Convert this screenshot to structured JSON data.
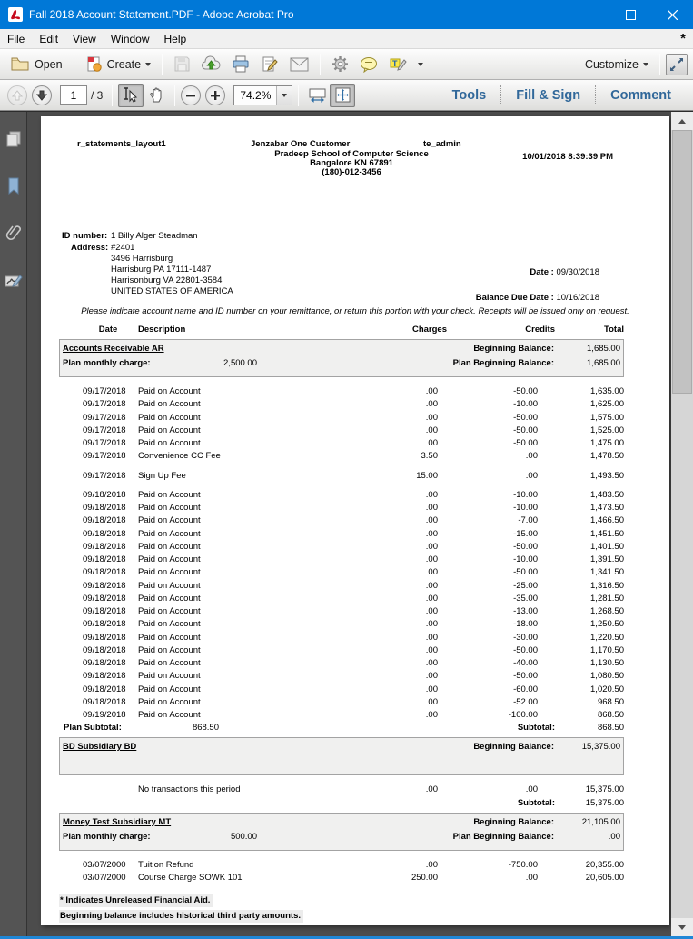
{
  "window": {
    "title": "Fall 2018 Account Statement.PDF - Adobe Acrobat Pro"
  },
  "menu": {
    "items": [
      "File",
      "Edit",
      "View",
      "Window",
      "Help"
    ]
  },
  "toolbar": {
    "open": "Open",
    "create": "Create",
    "customize": "Customize"
  },
  "navbar": {
    "page": "1",
    "page_total": "/ 3",
    "zoom": "74.2%",
    "tools": "Tools",
    "fill_sign": "Fill & Sign",
    "comment": "Comment"
  },
  "icons": {
    "titlebar": "acrobat-pdf-logo",
    "toolbar": [
      "open-folder-icon",
      "create-document-icon",
      "save-icon",
      "share-upload-icon",
      "print-icon",
      "sign-document-icon",
      "email-icon",
      "gear-icon",
      "comment-bubble-icon",
      "text-highlight-icon",
      "more-tools-chevron",
      "expand-window-icon"
    ],
    "navbar": [
      "previous-page-icon",
      "next-page-icon",
      "select-tool-icon",
      "hand-tool-icon",
      "zoom-out-icon",
      "zoom-in-icon",
      "fit-width-icon",
      "fit-page-icon"
    ],
    "sidebar": [
      "page-thumbnails-icon",
      "bookmarks-icon",
      "attachments-icon",
      "signatures-icon"
    ]
  },
  "statement": {
    "report_id": "r_statements_layout1",
    "customer": "Jenzabar One Customer",
    "admin_user": "te_admin",
    "school": {
      "name": "Pradeep School of Computer Science",
      "city_line": "Bangalore KN 67891",
      "phone": "(180)-012-3456"
    },
    "printed": "10/01/2018 8:39:39 PM",
    "id_label": "ID number:",
    "id_value": "1 Billy Alger Steadman",
    "address_label": "Address:",
    "address_lines": [
      "#2401",
      "3496 Harrisburg",
      "Harrisburg PA  17111-1487",
      "Harrisonburg VA 22801-3584",
      "UNITED STATES OF AMERICA"
    ],
    "date_label": "Date :",
    "date_value": "09/30/2018",
    "balance_due_label": "Balance Due Date :",
    "balance_due_value": "10/16/2018",
    "notice": "Please indicate account name and ID number on your remittance, or return this portion with your check.  Receipts will be issued only on request.",
    "columns": {
      "date": "Date",
      "description": "Description",
      "charges": "Charges",
      "credits": "Credits",
      "total": "Total"
    },
    "labels": {
      "beginning_balance": "Beginning Balance:",
      "plan_beginning_balance": "Plan Beginning Balance:",
      "plan_monthly_charge": "Plan monthly charge:",
      "plan_subtotal": "Plan Subtotal:",
      "subtotal": "Subtotal:"
    },
    "sections": [
      {
        "title": "Accounts Receivable AR",
        "beginning_balance": "1,685.00",
        "plan_monthly_charge": "2,500.00",
        "plan_beginning_balance": "1,685.00",
        "transactions": [
          {
            "date": "09/17/2018",
            "description": "Paid on Account",
            "charges": ".00",
            "credits": "-50.00",
            "total": "1,635.00"
          },
          {
            "date": "09/17/2018",
            "description": "Paid on Account",
            "charges": ".00",
            "credits": "-10.00",
            "total": "1,625.00"
          },
          {
            "date": "09/17/2018",
            "description": "Paid on Account",
            "charges": ".00",
            "credits": "-50.00",
            "total": "1,575.00"
          },
          {
            "date": "09/17/2018",
            "description": "Paid on Account",
            "charges": ".00",
            "credits": "-50.00",
            "total": "1,525.00"
          },
          {
            "date": "09/17/2018",
            "description": "Paid on Account",
            "charges": ".00",
            "credits": "-50.00",
            "total": "1,475.00"
          },
          {
            "date": "09/17/2018",
            "description": "Convenience CC Fee",
            "charges": "3.50",
            "credits": ".00",
            "total": "1,478.50"
          },
          {
            "date": "09/17/2018",
            "description": "Sign Up Fee",
            "charges": "15.00",
            "credits": ".00",
            "total": "1,493.50",
            "gap": true
          },
          {
            "date": "09/18/2018",
            "description": "Paid on Account",
            "charges": ".00",
            "credits": "-10.00",
            "total": "1,483.50",
            "gap": true
          },
          {
            "date": "09/18/2018",
            "description": "Paid on Account",
            "charges": ".00",
            "credits": "-10.00",
            "total": "1,473.50"
          },
          {
            "date": "09/18/2018",
            "description": "Paid on Account",
            "charges": ".00",
            "credits": "-7.00",
            "total": "1,466.50"
          },
          {
            "date": "09/18/2018",
            "description": "Paid on Account",
            "charges": ".00",
            "credits": "-15.00",
            "total": "1,451.50"
          },
          {
            "date": "09/18/2018",
            "description": "Paid on Account",
            "charges": ".00",
            "credits": "-50.00",
            "total": "1,401.50"
          },
          {
            "date": "09/18/2018",
            "description": "Paid on Account",
            "charges": ".00",
            "credits": "-10.00",
            "total": "1,391.50"
          },
          {
            "date": "09/18/2018",
            "description": "Paid on Account",
            "charges": ".00",
            "credits": "-50.00",
            "total": "1,341.50"
          },
          {
            "date": "09/18/2018",
            "description": "Paid on Account",
            "charges": ".00",
            "credits": "-25.00",
            "total": "1,316.50"
          },
          {
            "date": "09/18/2018",
            "description": "Paid on Account",
            "charges": ".00",
            "credits": "-35.00",
            "total": "1,281.50"
          },
          {
            "date": "09/18/2018",
            "description": "Paid on Account",
            "charges": ".00",
            "credits": "-13.00",
            "total": "1,268.50"
          },
          {
            "date": "09/18/2018",
            "description": "Paid on Account",
            "charges": ".00",
            "credits": "-18.00",
            "total": "1,250.50"
          },
          {
            "date": "09/18/2018",
            "description": "Paid on Account",
            "charges": ".00",
            "credits": "-30.00",
            "total": "1,220.50"
          },
          {
            "date": "09/18/2018",
            "description": "Paid on Account",
            "charges": ".00",
            "credits": "-50.00",
            "total": "1,170.50"
          },
          {
            "date": "09/18/2018",
            "description": "Paid on Account",
            "charges": ".00",
            "credits": "-40.00",
            "total": "1,130.50"
          },
          {
            "date": "09/18/2018",
            "description": "Paid on Account",
            "charges": ".00",
            "credits": "-50.00",
            "total": "1,080.50"
          },
          {
            "date": "09/18/2018",
            "description": "Paid on Account",
            "charges": ".00",
            "credits": "-60.00",
            "total": "1,020.50"
          },
          {
            "date": "09/18/2018",
            "description": "Paid on Account",
            "charges": ".00",
            "credits": "-52.00",
            "total": "968.50"
          },
          {
            "date": "09/19/2018",
            "description": "Paid on Account",
            "charges": ".00",
            "credits": "-100.00",
            "total": "868.50"
          }
        ],
        "plan_subtotal": "868.50",
        "subtotal": "868.50"
      },
      {
        "title": "BD Subsidiary BD",
        "beginning_balance": "15,375.00",
        "transactions": [
          {
            "date": "",
            "description": "No transactions this period",
            "charges": ".00",
            "credits": ".00",
            "total": "15,375.00"
          }
        ],
        "subtotal": "15,375.00"
      },
      {
        "title": "Money Test Subsidiary MT",
        "beginning_balance": "21,105.00",
        "plan_monthly_charge": "500.00",
        "plan_beginning_balance": ".00",
        "transactions": [
          {
            "date": "03/07/2000",
            "description": "Tuition Refund",
            "charges": ".00",
            "credits": "-750.00",
            "total": "20,355.00"
          },
          {
            "date": "03/07/2000",
            "description": "Course Charge SOWK 101",
            "charges": "250.00",
            "credits": ".00",
            "total": "20,605.00"
          }
        ]
      }
    ],
    "footnotes": [
      "* Indicates Unreleased Financial Aid.",
      "Beginning balance includes historical third party amounts."
    ]
  }
}
